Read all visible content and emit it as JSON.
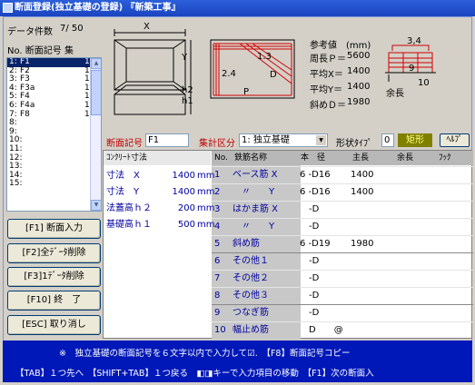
{
  "window": {
    "title": "断面登録(独立基礎の登録) 『新築工事』"
  },
  "summary": {
    "count_label": "データ件数",
    "count_value": "7/ 50"
  },
  "list": {
    "header": "No. 断面記号 集",
    "rows": [
      {
        "no": "1:",
        "code": "F1",
        "count": "1",
        "selected": true
      },
      {
        "no": "2:",
        "code": "F2",
        "count": "1"
      },
      {
        "no": "3:",
        "code": "F3",
        "count": "1"
      },
      {
        "no": "4:",
        "code": "F3a",
        "count": "1"
      },
      {
        "no": "5:",
        "code": "F4",
        "count": "1"
      },
      {
        "no": "6:",
        "code": "F4a",
        "count": "1"
      },
      {
        "no": "7:",
        "code": "F8",
        "count": "1"
      },
      {
        "no": "8:",
        "code": "",
        "count": ""
      },
      {
        "no": "9:",
        "code": "",
        "count": ""
      },
      {
        "no": "10:",
        "code": "",
        "count": ""
      },
      {
        "no": "11:",
        "code": "",
        "count": ""
      },
      {
        "no": "12:",
        "code": "",
        "count": ""
      },
      {
        "no": "13:",
        "code": "",
        "count": ""
      },
      {
        "no": "14:",
        "code": "",
        "count": ""
      },
      {
        "no": "15:",
        "code": "",
        "count": ""
      }
    ]
  },
  "buttons": {
    "f1": "[F1] 断面入力",
    "f2": "[F2]全ﾃﾞｰﾀ削除",
    "f3": "[F3]1ﾃﾞｰﾀ削除",
    "f10": "[F10] 終　了",
    "esc": "[ESC] 取り消し"
  },
  "diagram": {
    "x": "X",
    "y": "Y",
    "h2": "h2",
    "h1": "h1",
    "n13": "1.3",
    "n24": "2.4",
    "d": "D",
    "p": "P",
    "n34": "3,4",
    "n9": "9",
    "n10": "10",
    "yocho": "余長"
  },
  "reference": {
    "title": "参考値　(mm)",
    "p_label": "周長Ｐ＝",
    "p_value": "5600",
    "x_label": "平均X＝",
    "x_value": "1400",
    "y_label": "平均Y＝",
    "y_value": "1400",
    "d_label": "斜めＤ＝",
    "d_value": "1980"
  },
  "form": {
    "section_label": "断面記号",
    "section_value": "F1",
    "group_label": "集計区分",
    "group_value": "1: 独立基礎",
    "shape_label": "形状ﾀｲﾌﾟ",
    "shape_value": "0",
    "shape_name": "矩形",
    "help": "ﾍﾙﾌﾟ"
  },
  "concrete": {
    "header": "ｺﾝｸﾘｰﾄ寸法",
    "rows": [
      {
        "label": "寸法　X",
        "value": "1400",
        "unit": "mm"
      },
      {
        "label": "寸法　Y",
        "value": "1400",
        "unit": "mm"
      },
      {
        "label": "法蓋高ｈ２",
        "value": "200",
        "unit": "mm"
      },
      {
        "label": "基礎高ｈ１",
        "value": "500",
        "unit": "mm"
      }
    ]
  },
  "rebar": {
    "headers": {
      "no": "No.",
      "name": "鉄筋名称",
      "dia": "本　径",
      "main": "主長",
      "extra": "余長",
      "hook": "ﾌｯｸ"
    },
    "rows": [
      {
        "no": "1",
        "name": "ベース筋 X",
        "dia": "6 -D16",
        "len": "1400"
      },
      {
        "no": "2",
        "name": "　〃　　Y",
        "dia": "6 -D16",
        "len": "1400"
      },
      {
        "no": "3",
        "name": "はかま筋 X",
        "dia": "　-D",
        "len": ""
      },
      {
        "no": "4",
        "name": "　〃　　Y",
        "dia": "　-D",
        "len": ""
      },
      {
        "no": "5",
        "name": "斜め筋",
        "dia": "6 -D19",
        "len": "1980"
      },
      {
        "no": "6",
        "name": "その他１",
        "dia": "　-D",
        "len": ""
      },
      {
        "no": "7",
        "name": "その他２",
        "dia": "　-D",
        "len": ""
      },
      {
        "no": "8",
        "name": "その他３",
        "dia": "　-D",
        "len": ""
      },
      {
        "no": "9",
        "name": "つなぎ筋",
        "dia": "　-D",
        "len": ""
      },
      {
        "no": "10",
        "name": "幅止め筋",
        "dia": "　D　　@",
        "len": ""
      }
    ]
  },
  "status": {
    "line1": "※　独立基礎の断面記号を６文字以内で入力して☑.　【F8】断面記号コピー",
    "line2": "【TAB】１つ先へ　【SHIFT+TAB】１つ戻る　◧◨キーで入力項目の移動　【F1】次の断面入"
  },
  "colors": {
    "titlebar": "#1a44c0",
    "status_bg": "#0018b8",
    "red_label": "#c00000",
    "blue_text": "#0000a0",
    "shape_btn": "#808000"
  }
}
